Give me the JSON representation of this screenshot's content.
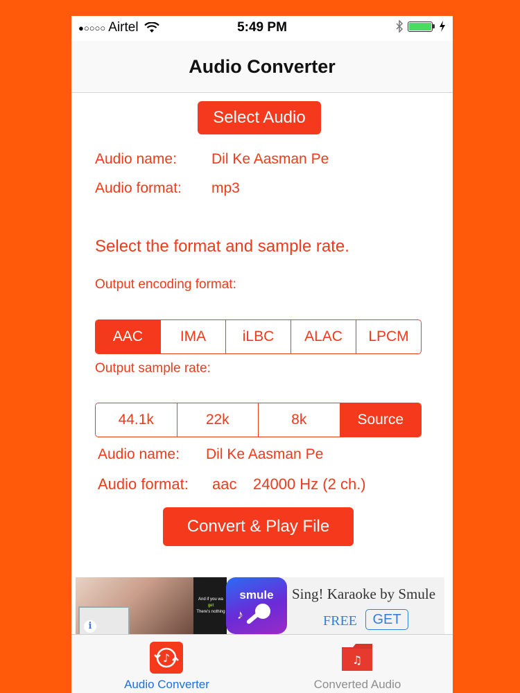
{
  "status_bar": {
    "signal_dots": "●○○○○",
    "carrier": "Airtel",
    "time": "5:49 PM"
  },
  "nav": {
    "title": "Audio Converter"
  },
  "select_button": "Select Audio",
  "source_info": {
    "name_label": "Audio name:",
    "name_value": "Dil Ke Aasman Pe",
    "format_label": "Audio format:",
    "format_value": "mp3"
  },
  "instruction": "Select the format and sample rate.",
  "encoding": {
    "label": "Output encoding format:",
    "options": [
      "AAC",
      "IMA",
      "iLBC",
      "ALAC",
      "LPCM"
    ],
    "selected": "AAC"
  },
  "sample_rate": {
    "label": "Output sample rate:",
    "options": [
      "44.1k",
      "22k",
      "8k",
      "Source"
    ],
    "selected": "Source"
  },
  "output_info": {
    "name_label": "Audio name:",
    "name_value": "Dil Ke Aasman Pe",
    "format_label": "Audio format:",
    "format_value": "aac",
    "rate_value": "24000 Hz (2 ch.)"
  },
  "convert_button": "Convert & Play File",
  "ad": {
    "title": "Sing! Karaoke by Smule",
    "price": "FREE",
    "cta": "GET",
    "app_name": "smule",
    "lyric_line1": "And if you wa",
    "lyric_line2": "get",
    "lyric_line3": "There's nothing"
  },
  "tabs": [
    {
      "label": "Audio Converter",
      "icon": "convert-icon",
      "active": true
    },
    {
      "label": "Converted Audio",
      "icon": "music-folder-icon",
      "active": false
    }
  ],
  "colors": {
    "background": "#ff5a0a",
    "accent": "#f5391c",
    "tab_active": "#1d6fe0"
  }
}
